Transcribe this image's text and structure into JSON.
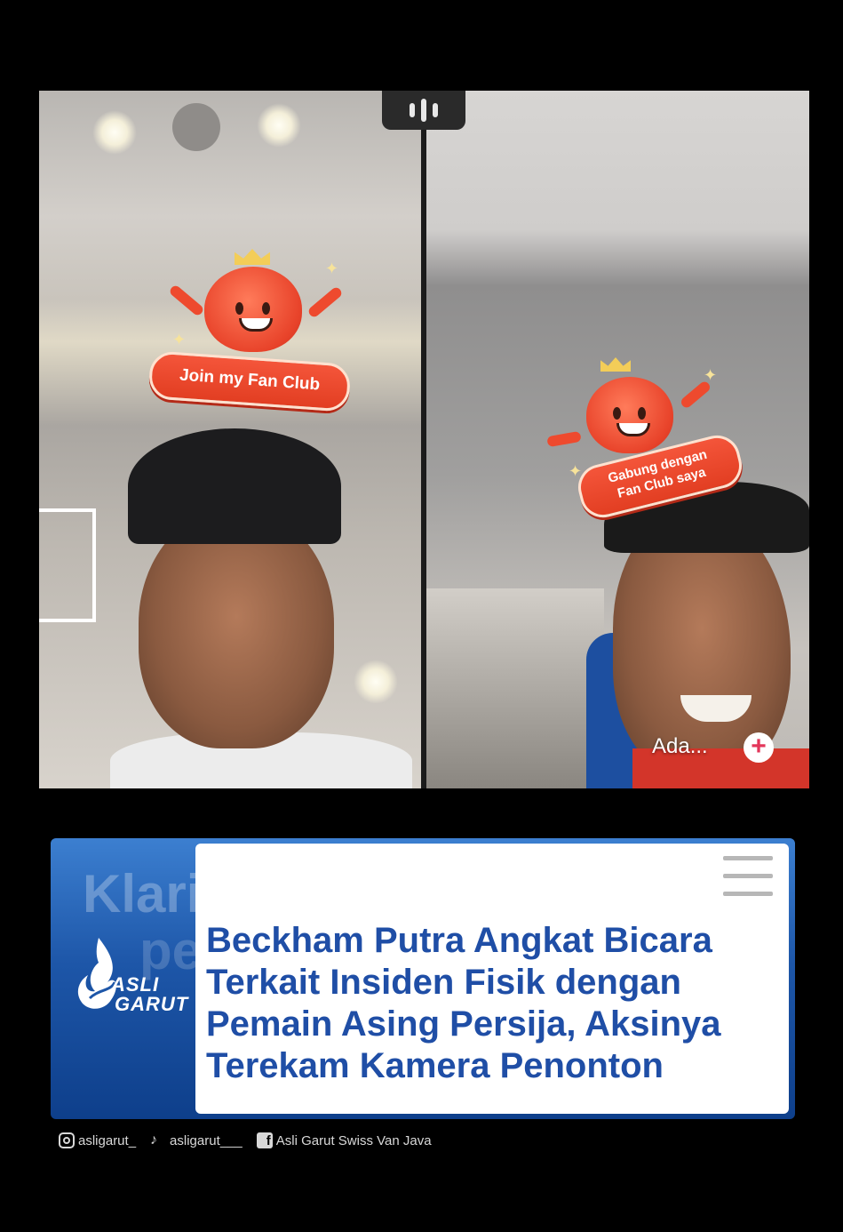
{
  "video": {
    "left_badge_text": "Join my Fan Club",
    "right_badge_text_line1": "Gabung dengan",
    "right_badge_text_line2": "Fan Club saya",
    "right_label": "Ada...",
    "plus_symbol": "+"
  },
  "news": {
    "bg_text_1": "Klari",
    "bg_text_2": "pe",
    "logo_line1": "ASLI",
    "logo_line2": "GARUT",
    "headline": "Beckham Putra Angkat Bicara Terkait Insiden Fisik dengan Pemain Asing Persija, Aksinya Terekam Kamera Penonton",
    "brand_color": "#1f4ea6"
  },
  "social": {
    "instagram": "asligarut_",
    "tiktok": "asligarut___",
    "facebook": "Asli Garut Swiss Van Java"
  }
}
